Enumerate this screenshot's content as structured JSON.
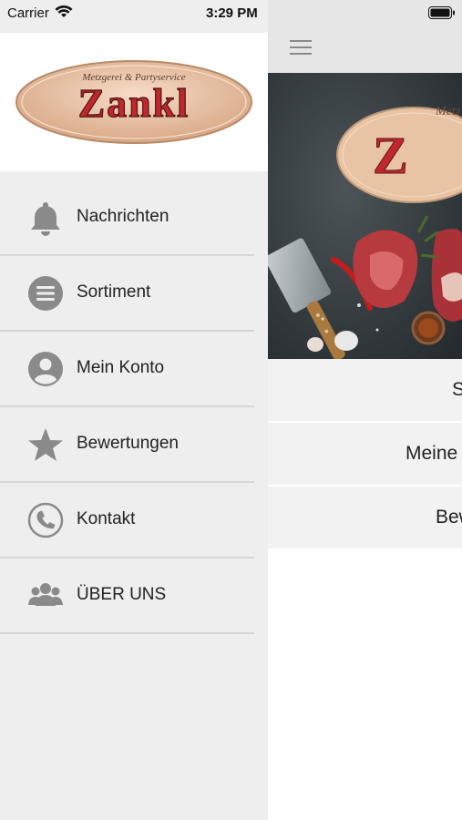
{
  "status_bar": {
    "carrier": "Carrier",
    "time": "3:29 PM"
  },
  "brand": {
    "logo_tagline": "Metzgerei & Partyservice",
    "logo_name": "Zankl"
  },
  "drawer": {
    "items": [
      {
        "label": "Nachrichten",
        "icon": "bell-icon"
      },
      {
        "label": "Sortiment",
        "icon": "list-icon"
      },
      {
        "label": "Mein Konto",
        "icon": "user-icon"
      },
      {
        "label": "Bewertungen",
        "icon": "star-icon"
      },
      {
        "label": "Kontakt",
        "icon": "phone-icon"
      },
      {
        "label": "ÜBER UNS",
        "icon": "group-icon"
      }
    ]
  },
  "main": {
    "hero_logo_partial": "Z",
    "rows": [
      {
        "label": "S"
      },
      {
        "label": "Meine"
      },
      {
        "label": "Bew"
      }
    ]
  },
  "colors": {
    "icon_gray": "#8a8a8a",
    "logo_red": "#c1272d",
    "logo_oval": "#e8c3a4"
  }
}
